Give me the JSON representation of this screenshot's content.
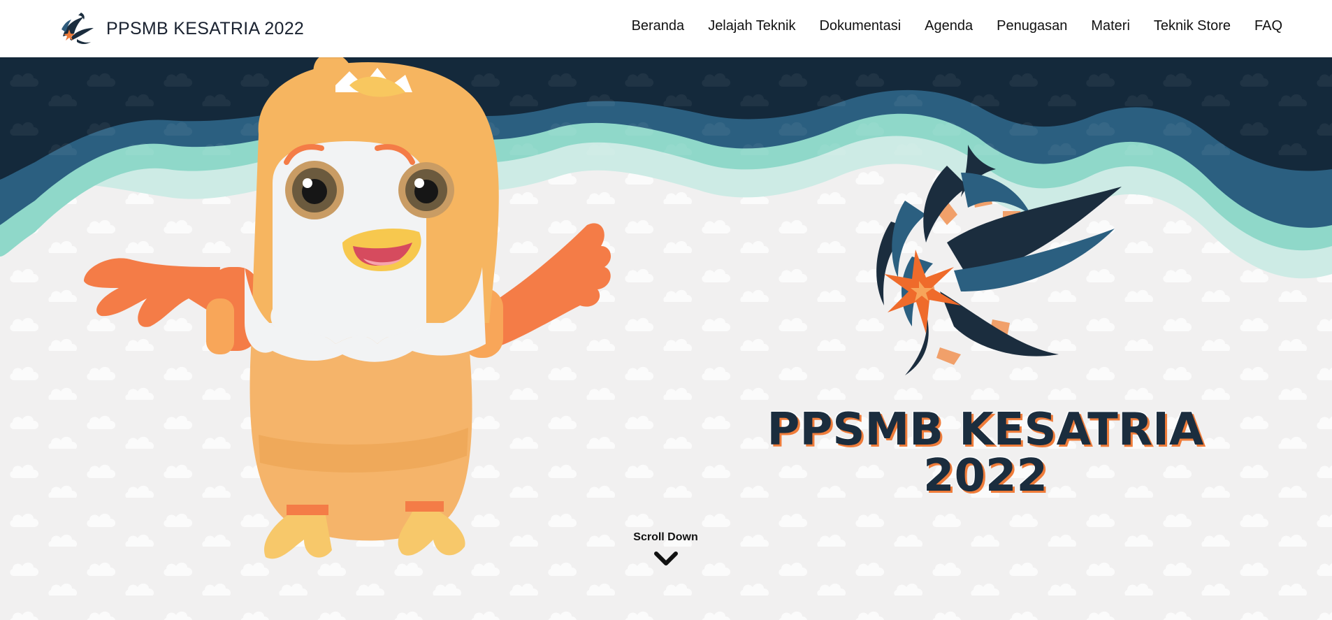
{
  "navbar": {
    "brand_text": "PPSMB KESATRIA 2022",
    "links": [
      {
        "label": "Beranda"
      },
      {
        "label": "Jelajah Teknik"
      },
      {
        "label": "Dokumentasi"
      },
      {
        "label": "Agenda"
      },
      {
        "label": "Penugasan"
      },
      {
        "label": "Materi"
      },
      {
        "label": "Teknik Store"
      },
      {
        "label": "FAQ"
      }
    ]
  },
  "hero": {
    "title_line1": "PPSMB KESATRIA",
    "title_line2": "2022",
    "scroll_label": "Scroll Down",
    "mascot_icon": "eagle-mascot",
    "emblem_icon": "kesatria-emblem",
    "scroll_icon": "chevron-down-icon"
  },
  "colors": {
    "navy": "#1b2d3e",
    "teal": "#7fd3c4",
    "orange": "#ef7c3a",
    "background": "#f1f0f0"
  }
}
